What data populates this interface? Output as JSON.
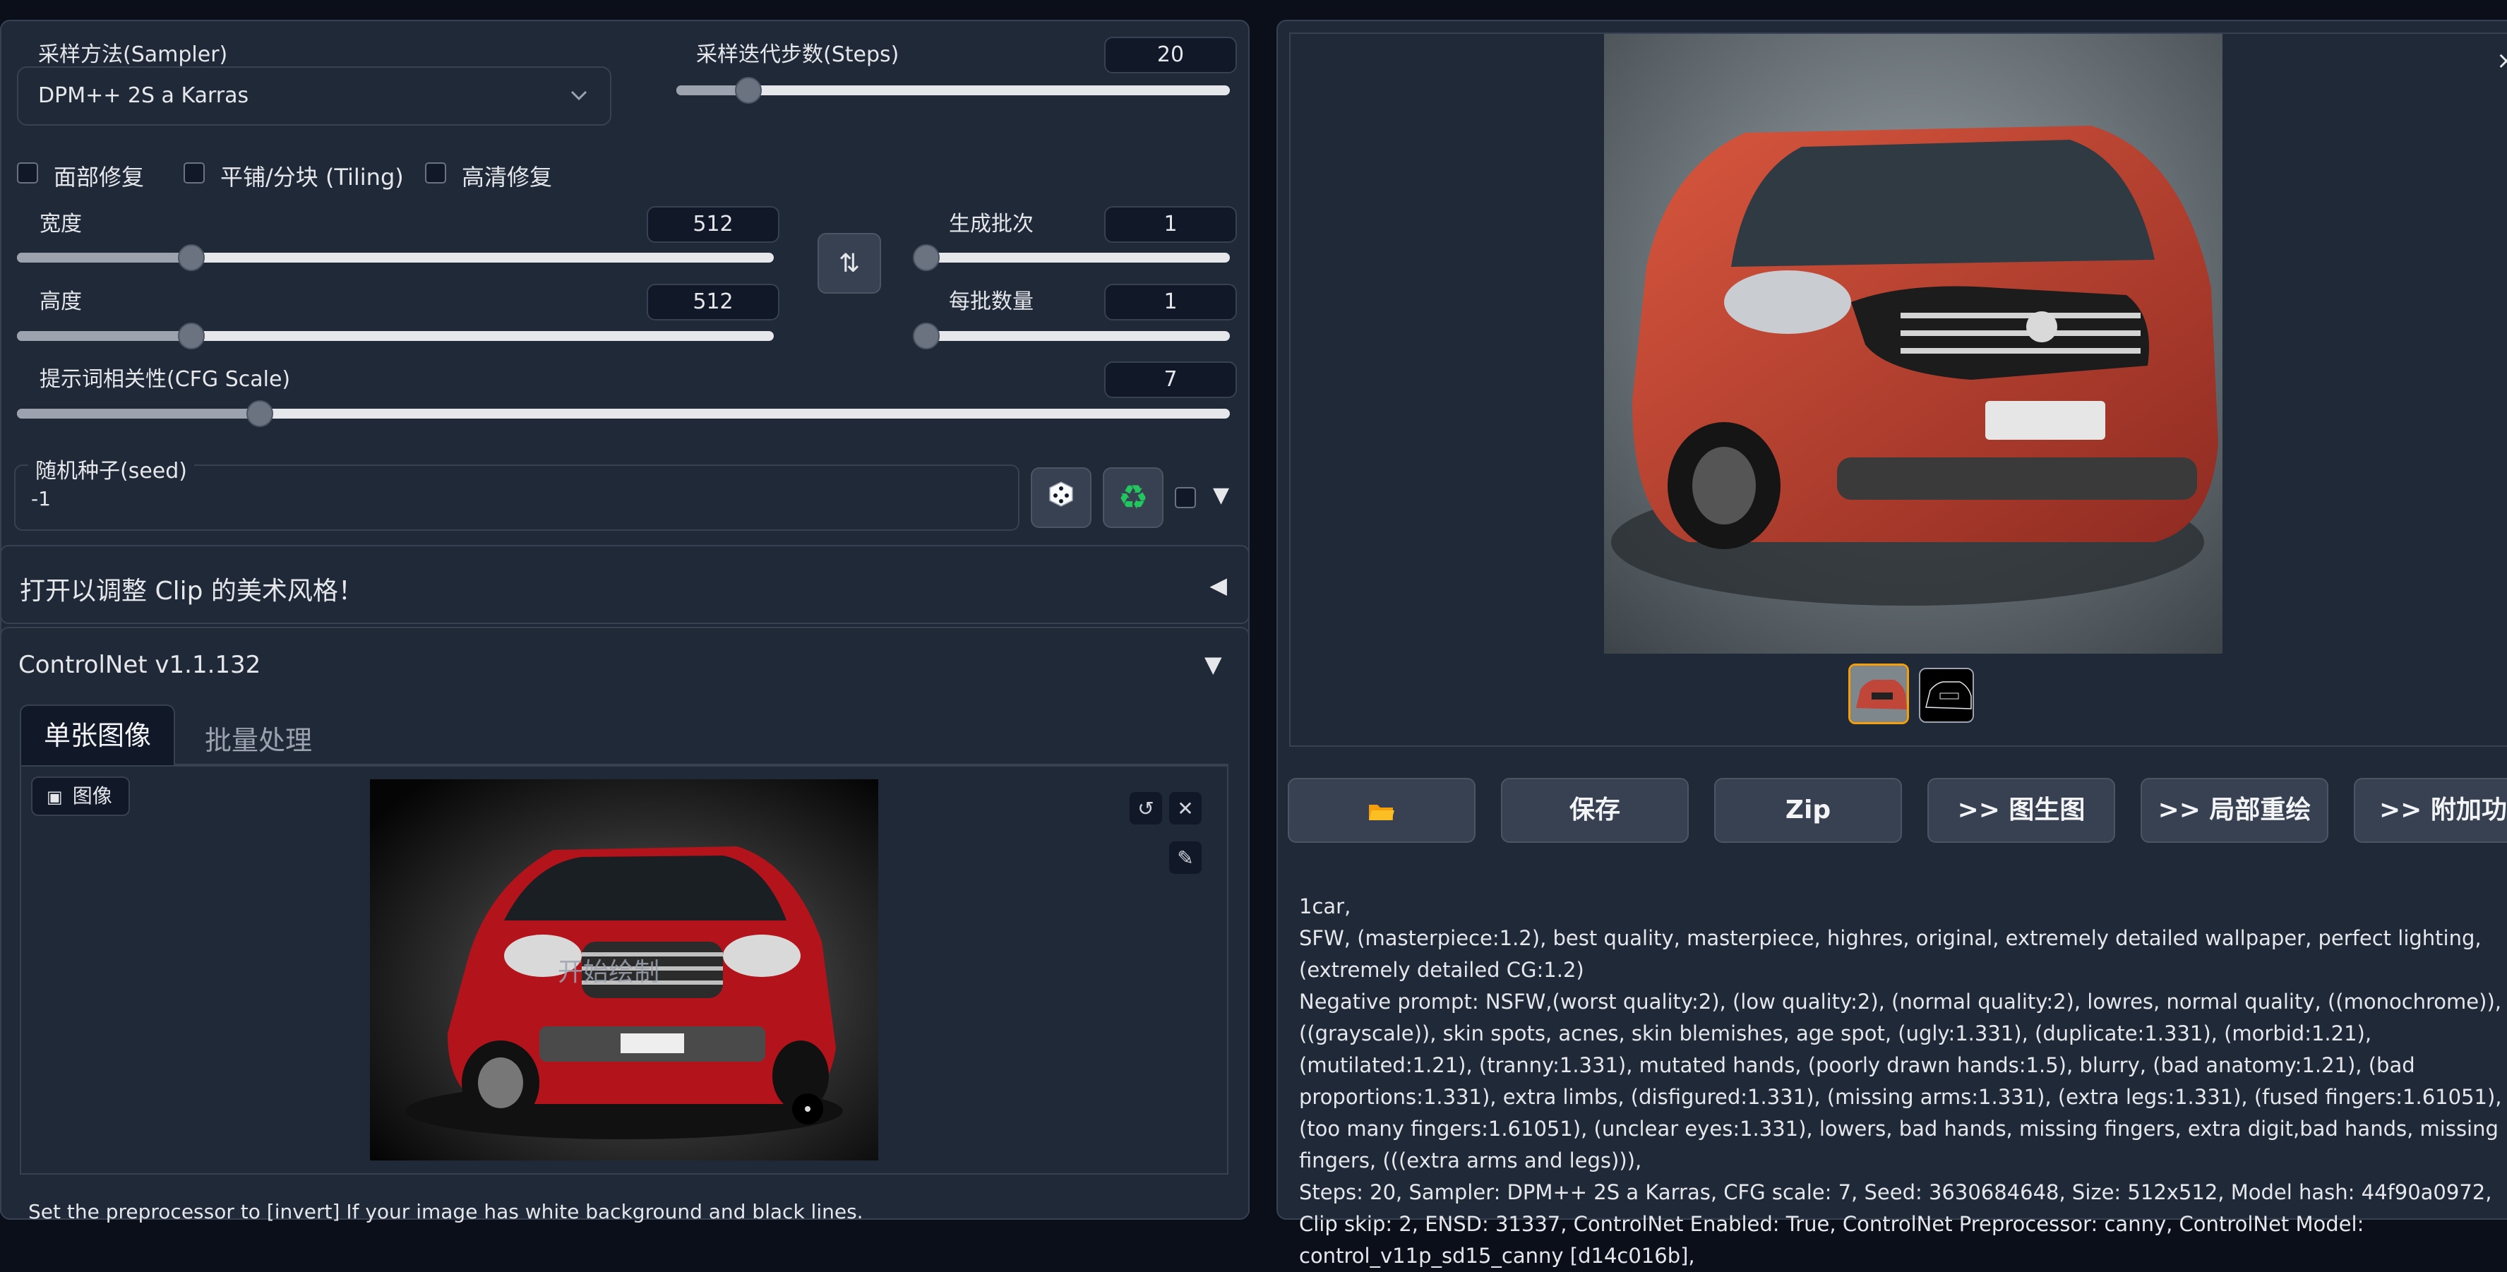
{
  "sampler": {
    "label": "采样方法(Sampler)",
    "value": "DPM++ 2S a Karras"
  },
  "steps": {
    "label": "采样迭代步数(Steps)",
    "value": "20",
    "fraction": 0.13
  },
  "checkboxes": [
    {
      "label": "面部修复",
      "checked": false
    },
    {
      "label": "平铺/分块 (Tiling)",
      "checked": false
    },
    {
      "label": "高清修复",
      "checked": false
    }
  ],
  "width": {
    "label": "宽度",
    "value": "512",
    "fraction": 0.23
  },
  "height": {
    "label": "高度",
    "value": "512",
    "fraction": 0.23
  },
  "swap_icon": "swap-vertical-icon",
  "batch_count": {
    "label": "生成批次",
    "value": "1",
    "fraction": 0.0
  },
  "batch_size": {
    "label": "每批数量",
    "value": "1",
    "fraction": 0.0
  },
  "cfg": {
    "label": "提示词相关性(CFG Scale)",
    "value": "7",
    "fraction": 0.2
  },
  "seed": {
    "label": "随机种子(seed)",
    "value": "-1",
    "dice_icon": "dice-icon",
    "recycle_icon": "recycle-icon",
    "extra_arrow": "▼"
  },
  "clip_accordion": {
    "title": "打开以调整 Clip 的美术风格！",
    "arrow": "◀"
  },
  "controlnet": {
    "title": "ControlNet v1.1.132",
    "arrow": "▼",
    "tabs": [
      "单张图像",
      "批量处理"
    ],
    "image_label": "图像",
    "overlay_text": "开始绘制",
    "footer_text": "Set the preprocessor to [invert] If your image has white background and black lines."
  },
  "gallery": {
    "close": "×"
  },
  "actions": {
    "folder_icon": "folder-icon",
    "save": "保存",
    "zip": "Zip",
    "img2img": ">> 图生图",
    "inpaint": ">> 局部重绘",
    "extras": ">> 附加功能"
  },
  "info": {
    "line1": "1car,",
    "line2": "SFW, (masterpiece:1.2), best quality, masterpiece, highres, original, extremely detailed wallpaper, perfect lighting,(extremely detailed CG:1.2)",
    "line3": "Negative prompt: NSFW,(worst quality:2), (low quality:2), (normal quality:2), lowres, normal quality, ((monochrome)), ((grayscale)), skin spots, acnes, skin blemishes, age spot, (ugly:1.331), (duplicate:1.331), (morbid:1.21), (mutilated:1.21), (tranny:1.331), mutated hands, (poorly drawn hands:1.5), blurry, (bad anatomy:1.21), (bad proportions:1.331), extra limbs, (disfigured:1.331), (missing arms:1.331), (extra legs:1.331), (fused fingers:1.61051), (too many fingers:1.61051), (unclear eyes:1.331), lowers, bad hands, missing fingers, extra digit,bad hands, missing fingers, (((extra arms and legs))),",
    "line4": "Steps: 20, Sampler: DPM++ 2S a Karras, CFG scale: 7, Seed: 3630684648, Size: 512x512, Model hash: 44f90a0972, Clip skip: 2, ENSD: 31337, ControlNet Enabled: True, ControlNet Preprocessor: canny, ControlNet Model: control_v11p_sd15_canny [d14c016b],"
  }
}
